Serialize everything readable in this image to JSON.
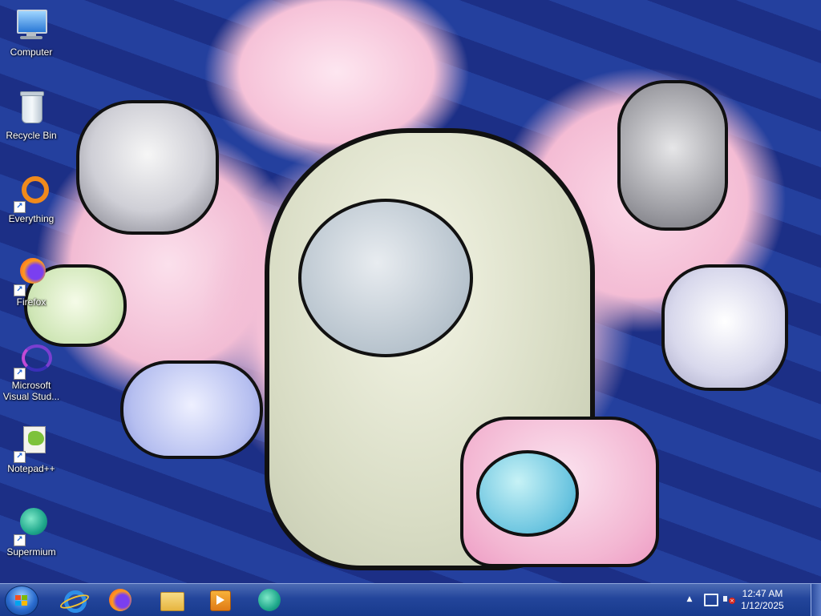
{
  "desktop_icons": [
    {
      "label": "Computer",
      "icon": "computer-icon"
    },
    {
      "label": "Recycle Bin",
      "icon": "recycle-bin-icon"
    },
    {
      "label": "Everything",
      "icon": "everything-search-icon"
    },
    {
      "label": "Firefox",
      "icon": "firefox-icon"
    },
    {
      "label": "Microsoft Visual Stud...",
      "icon": "visual-studio-icon"
    },
    {
      "label": "Notepad++",
      "icon": "notepadpp-icon"
    },
    {
      "label": "Supermium",
      "icon": "supermium-icon"
    }
  ],
  "taskbar": {
    "start_icon": "windows-start-icon",
    "pinned": [
      {
        "name": "Internet Explorer",
        "icon": "internet-explorer-icon"
      },
      {
        "name": "Firefox",
        "icon": "firefox-icon"
      },
      {
        "name": "File Explorer",
        "icon": "folder-icon"
      },
      {
        "name": "Media Player",
        "icon": "media-player-icon"
      },
      {
        "name": "Supermium",
        "icon": "supermium-icon"
      }
    ]
  },
  "tray": {
    "time": "12:47 AM",
    "date": "1/12/2025"
  },
  "colors": {
    "taskbar": "#23459b",
    "wallpaper_blue": "#1c2f86",
    "wallpaper_pink": "#f3bfd6"
  }
}
